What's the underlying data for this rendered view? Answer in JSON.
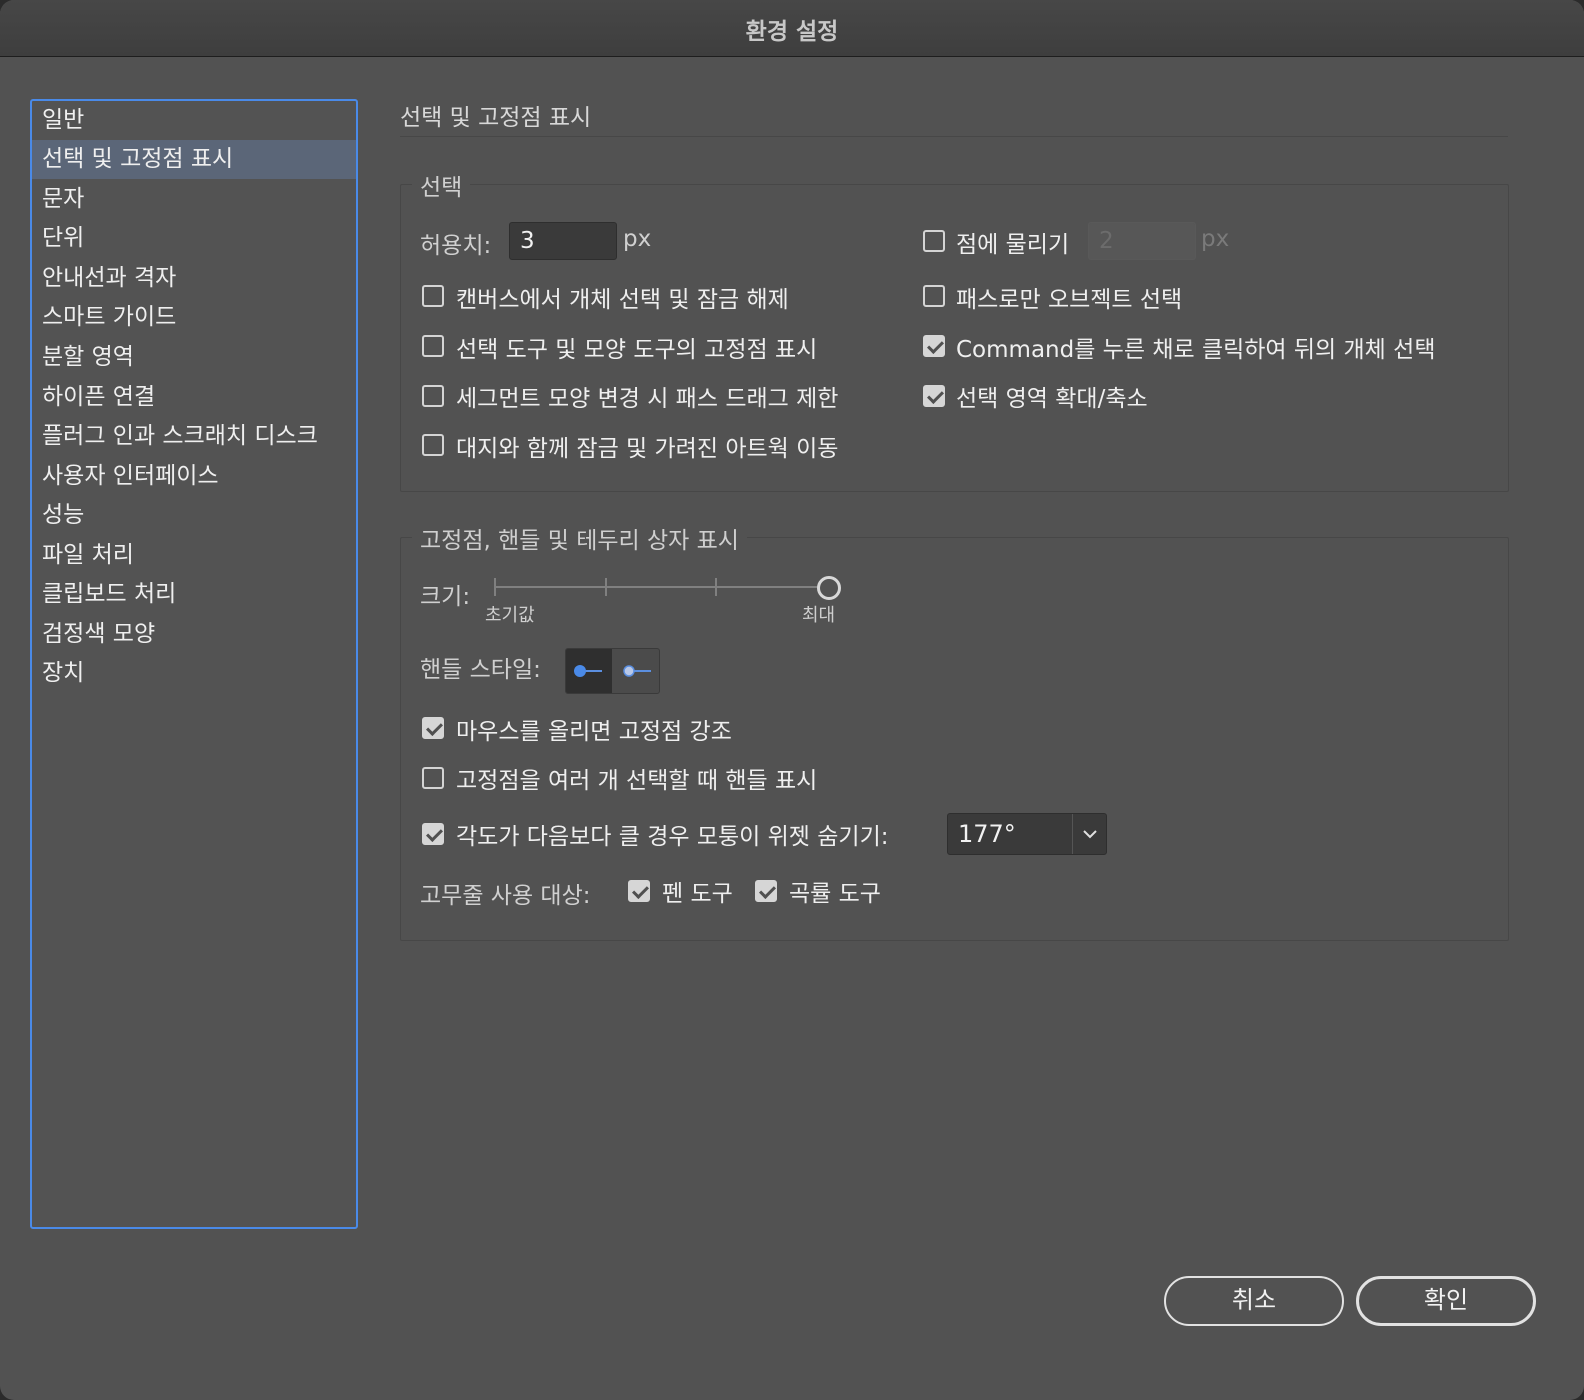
{
  "window": {
    "title": "환경 설정"
  },
  "sidebar": {
    "items": [
      {
        "label": "일반"
      },
      {
        "label": "선택 및 고정점 표시"
      },
      {
        "label": "문자"
      },
      {
        "label": "단위"
      },
      {
        "label": "안내선과 격자"
      },
      {
        "label": "스마트 가이드"
      },
      {
        "label": "분할 영역"
      },
      {
        "label": "하이픈 연결"
      },
      {
        "label": "플러그 인과 스크래치 디스크"
      },
      {
        "label": "사용자 인터페이스"
      },
      {
        "label": "성능"
      },
      {
        "label": "파일 처리"
      },
      {
        "label": "클립보드 처리"
      },
      {
        "label": "검정색 모양"
      },
      {
        "label": "장치"
      }
    ],
    "selected": "선택 및 고정점 표시"
  },
  "panel": {
    "title": "선택 및 고정점 표시",
    "selection": {
      "group_label": "선택",
      "tolerance_label": "허용치:",
      "tolerance_value": "3",
      "tolerance_unit": "px",
      "snap_to_point": {
        "label": "점에 물리기",
        "checked": false,
        "value": "2",
        "unit": "px"
      },
      "options_left": [
        {
          "label": "캔버스에서 개체 선택 및 잠금 해제",
          "checked": false
        },
        {
          "label": "선택 도구 및 모양 도구의 고정점 표시",
          "checked": false
        },
        {
          "label": "세그먼트 모양 변경 시 패스 드래그 제한",
          "checked": false
        },
        {
          "label": "대지와 함께 잠금 및 가려진 아트웍 이동",
          "checked": false
        }
      ],
      "options_right": [
        {
          "label": "패스로만 오브젝트 선택",
          "checked": false
        },
        {
          "label": "Command를 누른 채로 클릭하여 뒤의 개체 선택",
          "checked": true
        },
        {
          "label": "선택 영역 확대/축소",
          "checked": true
        }
      ]
    },
    "anchor_display": {
      "group_label": "고정점, 핸들 및 테두리 상자 표시",
      "size_label": "크기:",
      "size_min_label": "초기값",
      "size_max_label": "최대",
      "size_level": 1.0,
      "handle_style_label": "핸들 스타일:",
      "handle_styles": [
        {
          "icon": "handle-solid-icon",
          "selected": true
        },
        {
          "icon": "handle-hollow-icon",
          "selected": false
        }
      ],
      "options": [
        {
          "label": "마우스를 올리면 고정점 강조",
          "checked": true
        },
        {
          "label": "고정점을 여러 개 선택할 때 핸들 표시",
          "checked": false
        }
      ],
      "hide_widget": {
        "label": "각도가 다음보다 클 경우 모퉁이 위젯 숨기기:",
        "checked": true,
        "value": "177°"
      },
      "rubber_band": {
        "label": "고무줄 사용 대상:",
        "pen_tool": {
          "label": "펜 도구",
          "checked": true
        },
        "curvature_tool": {
          "label": "곡률 도구",
          "checked": true
        }
      }
    }
  },
  "footer": {
    "cancel_label": "취소",
    "ok_label": "확인"
  },
  "colors": {
    "accent": "#4a8ae8",
    "background": "#525252",
    "selected_row": "#5b6678"
  }
}
